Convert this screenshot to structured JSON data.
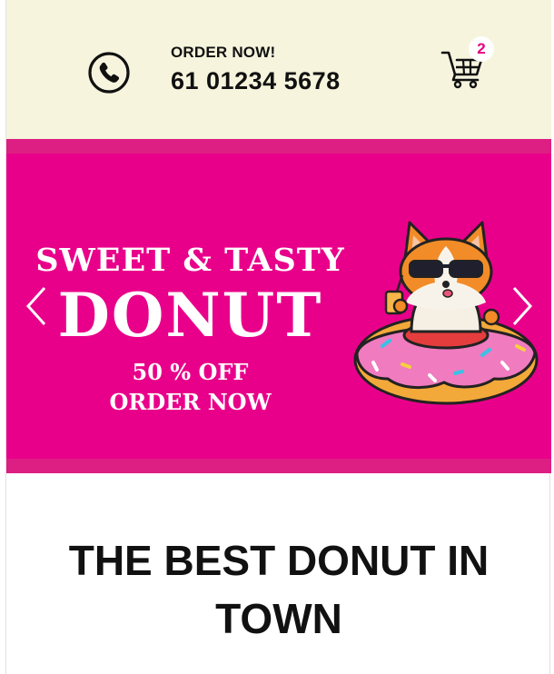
{
  "header": {
    "phone_icon": "phone-icon",
    "order_label": "ORDER NOW!",
    "phone_number": "61 01234 5678",
    "cart_icon": "cart-icon",
    "cart_count": "2",
    "background": "#f6f4dd"
  },
  "banner": {
    "line1": "SWEET & TASTY",
    "line2": "DONUT",
    "line3": "50 % OFF",
    "line4": "ORDER NOW",
    "prev_icon": "chevron-left-icon",
    "next_icon": "chevron-right-icon",
    "background": "#e9008a",
    "band_color": "#dd1f83"
  },
  "main": {
    "headline_line1": "THE BEST DONUT IN",
    "headline_line2": "TOWN"
  }
}
